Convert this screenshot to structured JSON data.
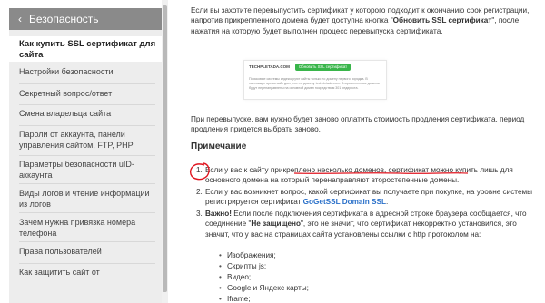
{
  "sidebar": {
    "back_icon": "‹",
    "header": "Безопасность",
    "items": [
      {
        "label": "Как купить SSL сертификат для сайта",
        "active": true
      },
      {
        "label": "Настройки безопасности"
      },
      {
        "label": "Секретный вопрос/ответ"
      },
      {
        "label": "Смена владельца сайта"
      },
      {
        "label": "Пароли от аккаунта, панели управления сайтом, FTP, PHP"
      },
      {
        "label": "Параметры безопасности uID-аккаунта"
      },
      {
        "label": "Виды логов и чтение информации из логов"
      },
      {
        "label": "Зачем нужна привязка номера телефона"
      },
      {
        "label": "Права пользователей"
      },
      {
        "label": "Как защитить сайт от"
      }
    ]
  },
  "main": {
    "intro": {
      "t1": "Если вы захотите перевыпустить сертификат у которого подходит к окончанию срок регистрации, напротив прикрепленного домена будет доступна кнопка \"",
      "b1": "Обновить SSL сертификат",
      "t2": "\", после нажатия на которую будет выполнен процесс перевыпуска сертификата."
    },
    "screenshot": {
      "domain": "TECHPLETADA.COM",
      "button": "Обновить SSL сертификат",
      "text": "Поисковые системы индексируют сайты только по домену первого порядка. В настоящее время сайт доступен по домену techpletada.com. Второстепенные домены будут перенаправлены на основной домен посредством 301 редиректа."
    },
    "reissue": "При перевыпуске, вам нужно будет заново оплатить стоимость продления сертификата, период продления придется выбрать заново.",
    "note_title": "Примечание",
    "list": [
      {
        "num": "1.",
        "text": "Если у вас к сайту прикреплено несколько доменов, сертификат можно купить лишь для основного домена на который перенаправляют второстепенные домены."
      },
      {
        "num": "2.",
        "t1": "Если у вас возникнет вопрос, какой сертификат вы получаете при покупке, на уровне системы регистрируется сертификат ",
        "link": "GoGetSSL Domain SSL",
        "t2": "."
      },
      {
        "num": "3.",
        "bold": "Важно!",
        "t1": " Если после подключения сертификата в адресной строке браузера сообщается, что соединение \"",
        "bold2": "Не защищено",
        "t2": "\", это не значит, что сертификат некорректно установился, это значит, что у вас на страницах сайта установлены ссылки с http протоколом на:"
      }
    ],
    "bullets": [
      "Изображения;",
      "Скрипты js;",
      "Видео;",
      "Google и Яндекс карты;",
      "Iframe;"
    ]
  },
  "colors": {
    "annotation": "#e0141e",
    "link": "#2a70c9",
    "sidebar_header": "#8a8a8a"
  }
}
